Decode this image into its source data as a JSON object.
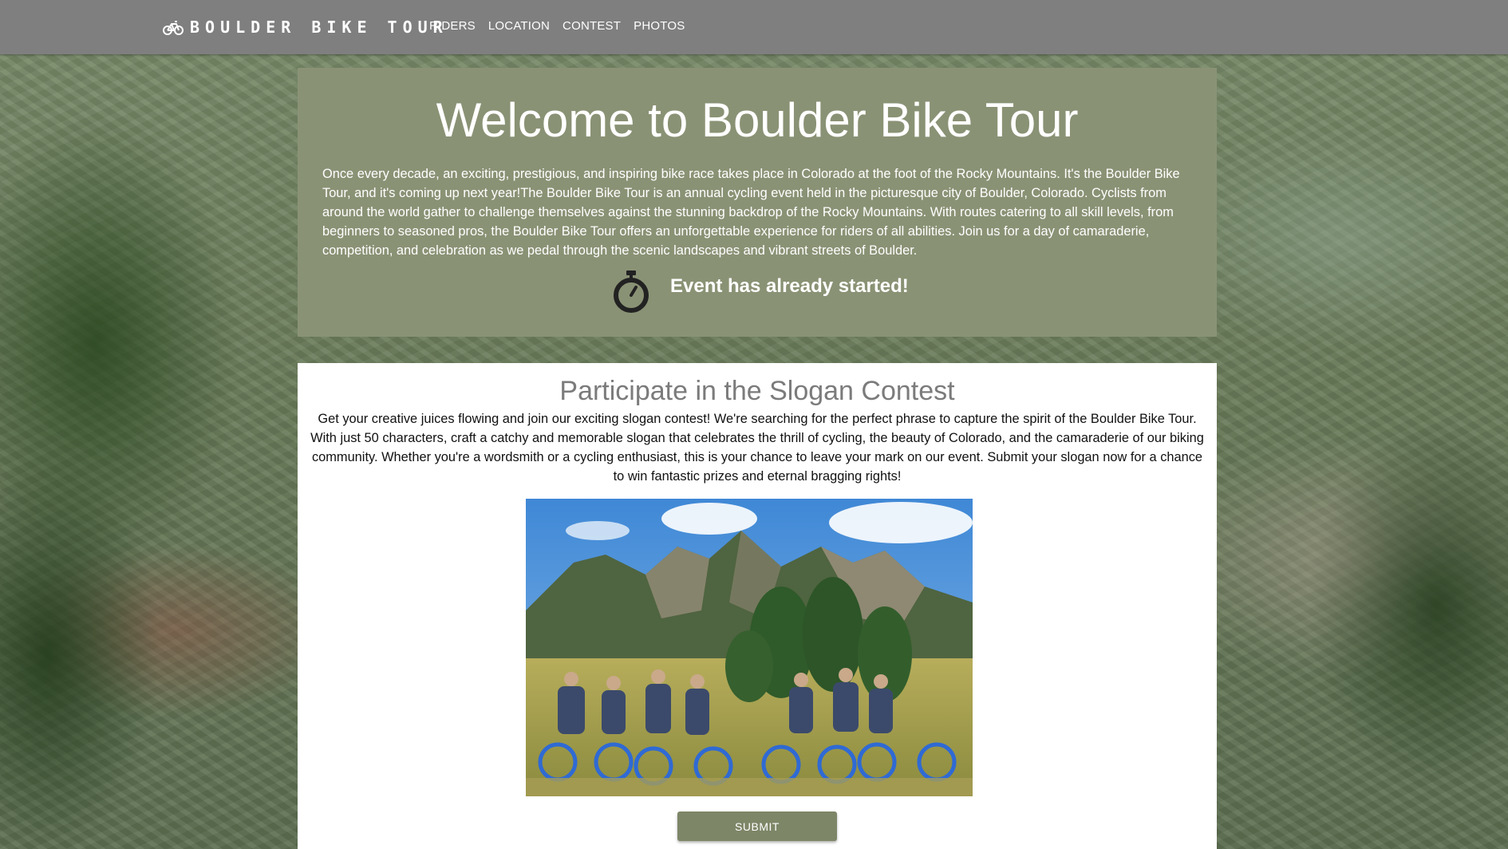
{
  "navbar": {
    "brand": "BOULDER BIKE TOUR",
    "brand_icon": "bicycle-icon",
    "links": [
      "RIDERS",
      "LOCATION",
      "CONTEST",
      "PHOTOS"
    ]
  },
  "hero": {
    "title": "Welcome to Boulder Bike Tour",
    "description": "Once every decade, an exciting, prestigious, and inspiring bike race takes place in Colorado at the foot of the Rocky Mountains. It's the Boulder Bike Tour, and it's coming up next year!The Boulder Bike Tour is an annual cycling event held in the picturesque city of Boulder, Colorado. Cyclists from around the world gather to challenge themselves against the stunning backdrop of the Rocky Mountains. With routes catering to all skill levels, from beginners to seasoned pros, the Boulder Bike Tour offers an unforgettable experience for riders of all abilities. Join us for a day of camaraderie, competition, and celebration as we pedal through the scenic landscapes and vibrant streets of Boulder.",
    "status_icon": "stopwatch-icon",
    "status_text": "Event has already started!"
  },
  "contest": {
    "title": "Participate in the Slogan Contest",
    "description": "Get your creative juices flowing and join our exciting slogan contest! We're searching for the perfect phrase to capture the spirit of the Boulder Bike Tour. With just 50 characters, craft a catchy and memorable slogan that celebrates the thrill of cycling, the beauty of Colorado, and the camaraderie of our biking community. Whether you're a wordsmith or a cycling enthusiast, this is your chance to leave your mark on our event. Submit your slogan now for a chance to win fantastic prizes and eternal bragging rights!",
    "submit_label": "SUBMIT"
  },
  "colors": {
    "navbar": "#7f7f7f",
    "hero_panel": "#8a9275",
    "button": "#7d8667"
  }
}
